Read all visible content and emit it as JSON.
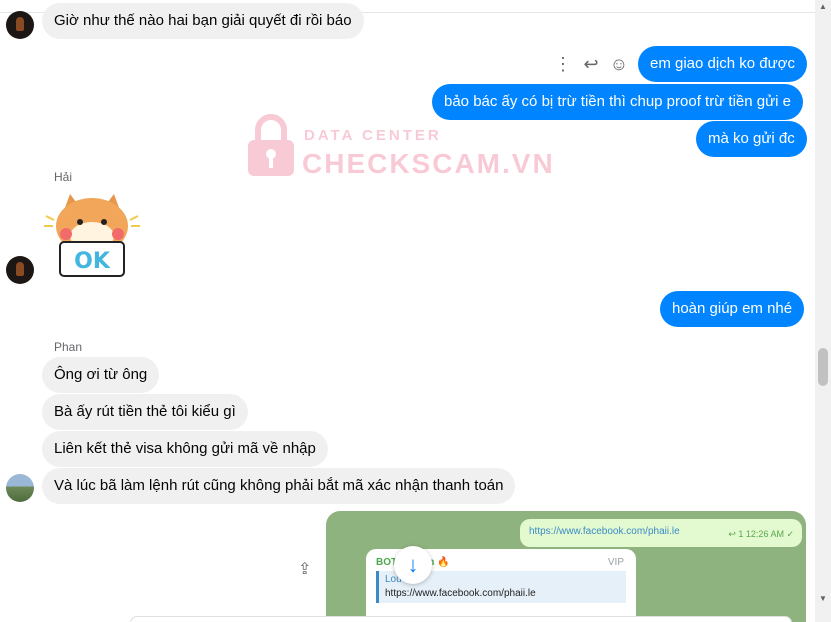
{
  "watermark": {
    "subtitle": "DATA CENTER",
    "title": "CHECKSCAM.VN"
  },
  "messages": {
    "m1": "Giờ như thế nào hai bạn giải quyết đi rồi báo",
    "o1": "em giao dịch ko được",
    "o2": "bảo bác ấy có bị trừ tiền thì chup proof trừ tiền gửi e",
    "o3": "mà ko gửi đc",
    "sender_haii": "Hải",
    "sticker_text": "OK",
    "o4": "hoàn giúp em nhé",
    "sender_phan": "Phan",
    "p1": "Ông ơi từ ông",
    "p2": "Bà ấy rút tiền thẻ tôi kiểu gì",
    "p3": "Liên kết thẻ visa không gửi mã về nhập",
    "p4": "Và lúc bã làm lệnh rút cũng không phải bắt mã xác nhận thanh toán"
  },
  "telegram_image": {
    "link": "https://www.facebook.com/phaii.le",
    "meta": "↩ 1  12:26 AM ✓",
    "bot_name": "BOT   cam.vn 🔥",
    "vip": "VIP",
    "quote_title": "Lou",
    "quote_link": "https://www.facebook.com/phaii.le"
  },
  "icons": {
    "more": "more-vertical-icon",
    "reply": "reply-icon",
    "react": "smile-icon",
    "scroll_down": "arrow-down-icon",
    "share": "share-icon"
  },
  "colors": {
    "outgoing": "#0084ff",
    "incoming": "#f0f0f0",
    "watermark": "#f4a0b3"
  }
}
